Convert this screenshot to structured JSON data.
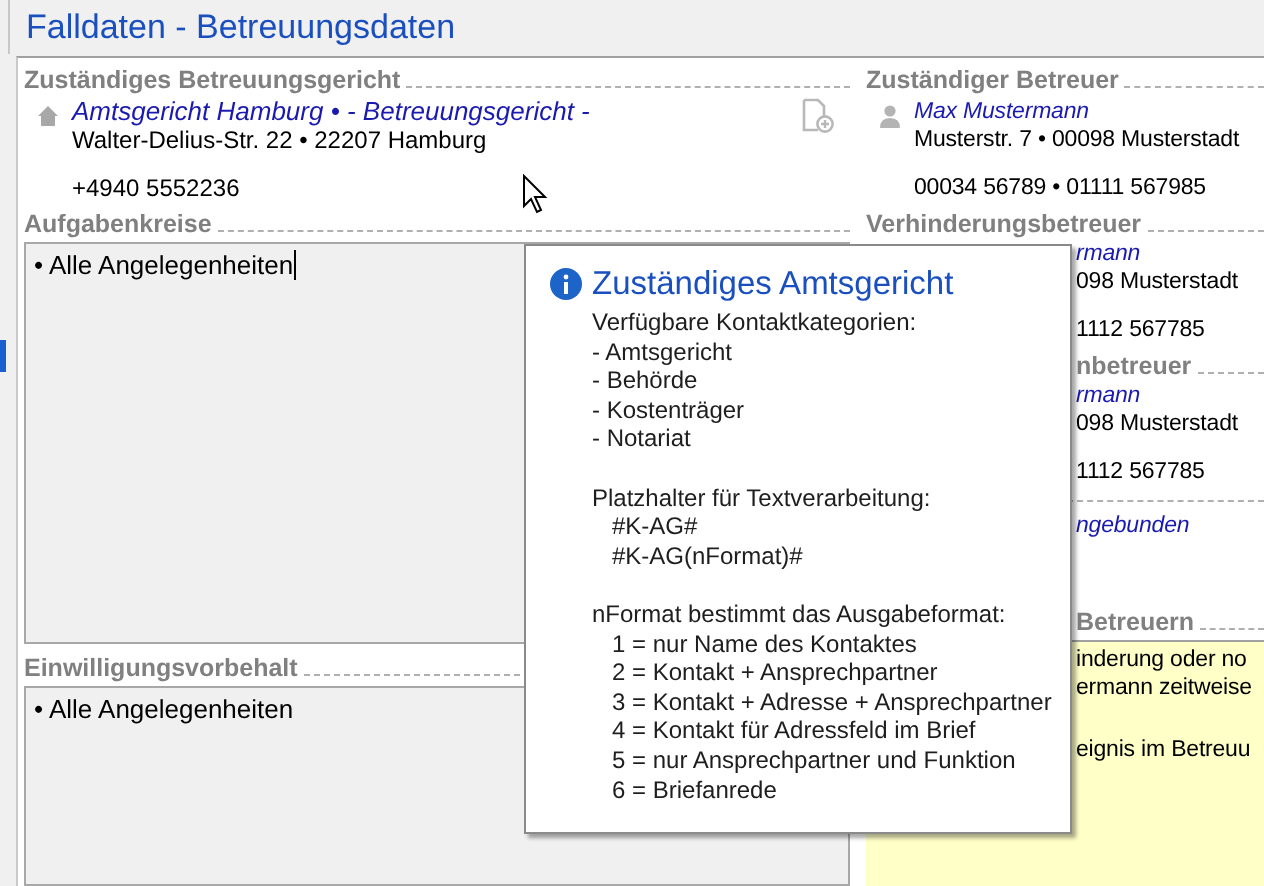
{
  "window": {
    "title": "Falldaten - Betreuungsdaten"
  },
  "court": {
    "heading": "Zuständiges Betreuungsgericht",
    "name": "Amtsgericht Hamburg • - Betreuungsgericht -",
    "address": "Walter-Delius-Str. 22 • 22207 Hamburg",
    "phone": "+4940 5552236"
  },
  "fields": [
    {
      "heading": "Aufgabenkreise",
      "value": "• Alle Angelegenheiten",
      "focused": true
    },
    {
      "heading": "Einwilligungsvorbehalt",
      "value": "• Alle Angelegenheiten",
      "focused": false
    }
  ],
  "right_column": [
    {
      "kind": "contact",
      "heading": "Zuständiger Betreuer",
      "name": "Max Mustermann",
      "address": "Musterstr. 7 • 00098 Musterstadt",
      "phone": "00034 56789 • 01111 567985"
    },
    {
      "kind": "contact_covered",
      "heading": "Verhinderungsbetreuer",
      "name": "rmann",
      "address": "098 Musterstadt",
      "phone": "1112 567785"
    },
    {
      "kind": "contact_hidden",
      "heading": "nbetreuer",
      "name": "rmann",
      "address": "098 Musterstadt",
      "phone": "1112 567785"
    },
    {
      "kind": "link_hidden",
      "name": "ngebunden"
    },
    {
      "kind": "note_hidden",
      "heading": "Betreuern",
      "paragraphs": [
        [
          "inderung oder no",
          "ermann zeitweise"
        ],
        [
          "eignis im Betreuu"
        ]
      ]
    }
  ],
  "tooltip": {
    "title": "Zuständiges Amtsgericht",
    "paragraphs": [
      {
        "kind": "list",
        "heading": "Verfügbare Kontaktkategorien:",
        "lines": [
          "- Amtsgericht",
          "- Behörde",
          "- Kostenträger",
          "- Notariat"
        ]
      },
      {
        "kind": "indented",
        "heading": "Platzhalter für Textverarbeitung:",
        "lines": [
          "#K-AG#",
          "#K-AG(nFormat)#"
        ]
      },
      {
        "kind": "indented",
        "heading": "nFormat bestimmt das Ausgabeformat:",
        "lines": [
          "1 = nur Name des Kontaktes",
          "2 = Kontakt + Ansprechpartner",
          "3 = Kontakt + Adresse + Ansprechpartner",
          "4 = Kontakt für Adressfeld im Brief",
          "5 = nur Ansprechpartner und Funktion",
          "6 = Briefanrede"
        ]
      }
    ]
  }
}
